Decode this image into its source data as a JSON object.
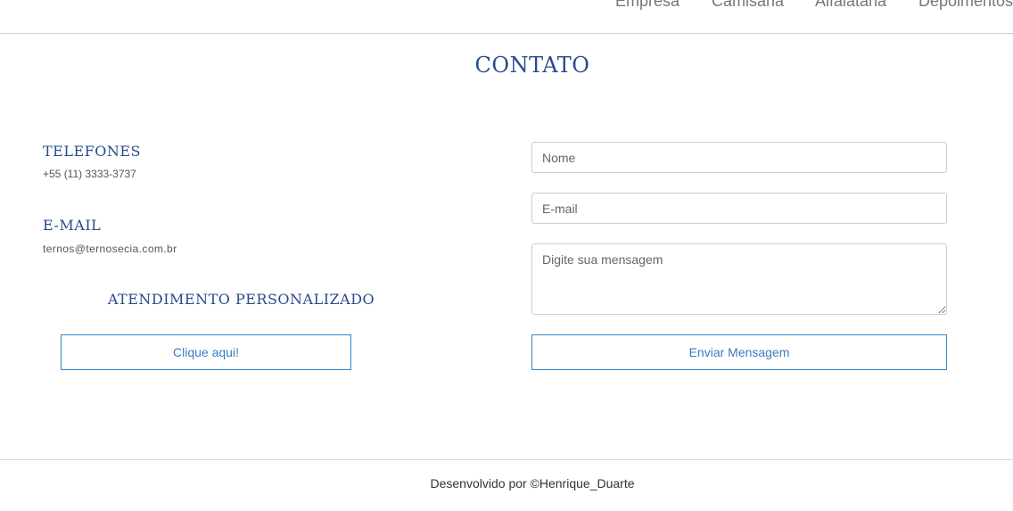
{
  "nav": {
    "items": [
      {
        "label": "Empresa"
      },
      {
        "label": "Camisaria"
      },
      {
        "label": "Alfaiataria"
      },
      {
        "label": "Depoimentos"
      }
    ]
  },
  "page": {
    "title": "CONTATO"
  },
  "contact": {
    "phones_heading": "TELEFONES",
    "phone": "+55 (11) 3333-3737",
    "email_heading": "E-MAIL",
    "email": "ternos@ternosecia.com.br",
    "personal_heading": "ATENDIMENTO PERSONALIZADO",
    "personal_button": "Clique aqui!"
  },
  "form": {
    "name_placeholder": "Nome",
    "email_placeholder": "E-mail",
    "message_placeholder": "Digite sua mensagem",
    "submit_label": "Enviar Mensagem"
  },
  "footer": {
    "text": "Desenvolvido por ©Henrique_Duarte"
  }
}
